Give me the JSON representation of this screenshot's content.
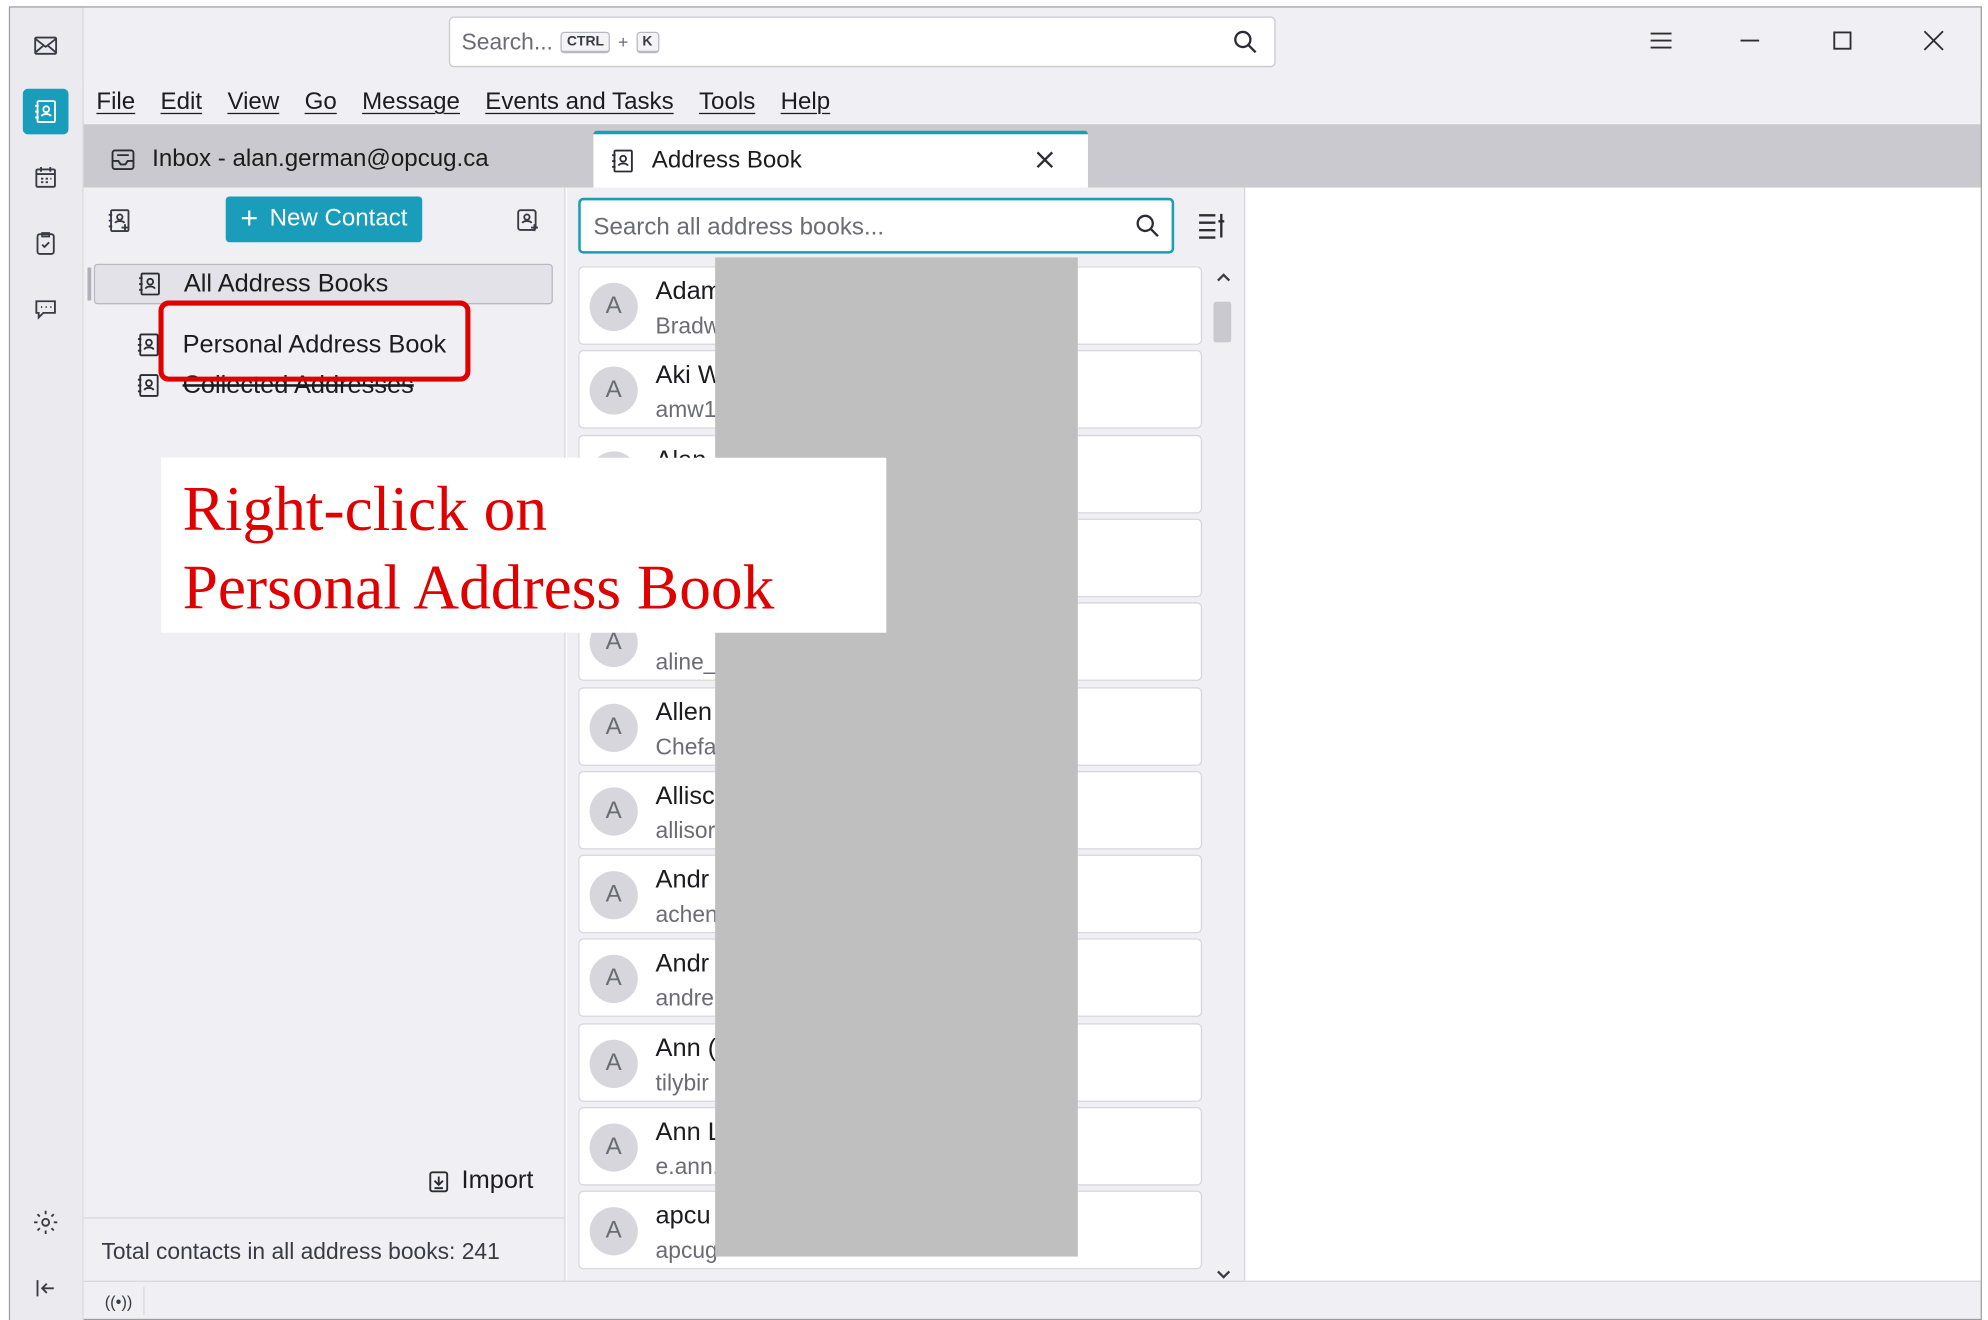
{
  "topbar": {
    "search_placeholder": "Search...",
    "shortcut_key1": "CTRL",
    "shortcut_plus": "+",
    "shortcut_key2": "K"
  },
  "menubar": {
    "items": [
      "File",
      "Edit",
      "View",
      "Go",
      "Message",
      "Events and Tasks",
      "Tools",
      "Help"
    ]
  },
  "tabs": [
    {
      "label": "Inbox - alan.german@opcug.ca",
      "icon": "inbox-icon",
      "active": false
    },
    {
      "label": "Address Book",
      "icon": "address-book-icon",
      "active": true
    }
  ],
  "books_pane": {
    "new_contact_label": "New Contact",
    "books": [
      {
        "label": "All Address Books",
        "selected": true
      },
      {
        "label": "Personal Address Book",
        "selected": false
      },
      {
        "label": "Collected Addresses",
        "selected": false
      }
    ],
    "import_label": "Import",
    "total_text": "Total contacts in all address books: 241"
  },
  "contacts": {
    "search_placeholder": "Search all address books...",
    "items": [
      {
        "initial": "A",
        "name": "Adam",
        "email": "Bradw"
      },
      {
        "initial": "A",
        "name": "Aki W",
        "email": "amw1"
      },
      {
        "initial": "A",
        "name": "Alan",
        "email": ""
      },
      {
        "initial": "A",
        "name": "",
        "email": ""
      },
      {
        "initial": "A",
        "name": "",
        "email": "aline_"
      },
      {
        "initial": "A",
        "name": "Allen",
        "email": "Chefa"
      },
      {
        "initial": "A",
        "name": "Allisc",
        "email": "allisor"
      },
      {
        "initial": "A",
        "name": "Andr",
        "email": "achen"
      },
      {
        "initial": "A",
        "name": "Andr",
        "email": "andre"
      },
      {
        "initial": "A",
        "name": "Ann (",
        "email": "tilybir"
      },
      {
        "initial": "A",
        "name": "Ann L",
        "email": "e.ann."
      },
      {
        "initial": "A",
        "name": "apcu",
        "email": "apcug"
      }
    ]
  },
  "annotation": {
    "line1": "Right-click on",
    "line2": "Personal Address Book"
  },
  "colors": {
    "accent": "#1a9dbb",
    "annotation_red": "#e00000",
    "redaction_gray": "#bfbfbf"
  }
}
